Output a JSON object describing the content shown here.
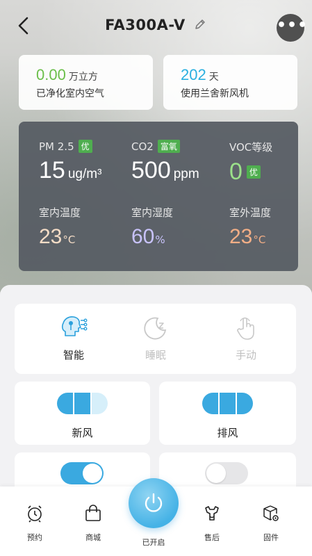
{
  "header": {
    "title": "FA300A-V"
  },
  "stats": {
    "purified": {
      "value": "0.00",
      "unit": "万立方",
      "label": "已净化室内空气",
      "color": "#6bbf4a"
    },
    "days": {
      "value": "202",
      "unit": "天",
      "label": "使用兰舍新风机",
      "color": "#2ab0e0"
    }
  },
  "air": {
    "pm25": {
      "label": "PM 2.5",
      "badge": "优",
      "value": "15",
      "unit": "ug/m³"
    },
    "co2": {
      "label": "CO2",
      "badge": "富氧",
      "value": "500",
      "unit": "ppm"
    },
    "voc": {
      "label": "VOC等级",
      "badge": "优",
      "value": "0"
    },
    "indoor_temp": {
      "label": "室内温度",
      "value": "23",
      "unit": "°C"
    },
    "indoor_humidity": {
      "label": "室内湿度",
      "value": "60",
      "unit": "%"
    },
    "outdoor_temp": {
      "label": "室外温度",
      "value": "23",
      "unit": "°C"
    }
  },
  "modes": [
    {
      "label": "智能",
      "active": true
    },
    {
      "label": "睡眠",
      "active": false
    },
    {
      "label": "手动",
      "active": false
    }
  ],
  "fans": [
    {
      "label": "新风",
      "level": 2,
      "max": 3
    },
    {
      "label": "排风",
      "level": 3,
      "max": 3
    }
  ],
  "toggles": [
    {
      "on": true
    },
    {
      "on": false
    }
  ],
  "tabs": {
    "schedule": "预约",
    "mall": "商城",
    "power": "已开启",
    "after_sales": "售后",
    "firmware": "固件"
  },
  "colors": {
    "accent": "#3aa9e0",
    "green": "#6bbf4a",
    "purple": "#b8b0f5",
    "orange": "#f0b08a",
    "badge_green": "#4fae4f",
    "inactive": "#c8c8c8"
  }
}
